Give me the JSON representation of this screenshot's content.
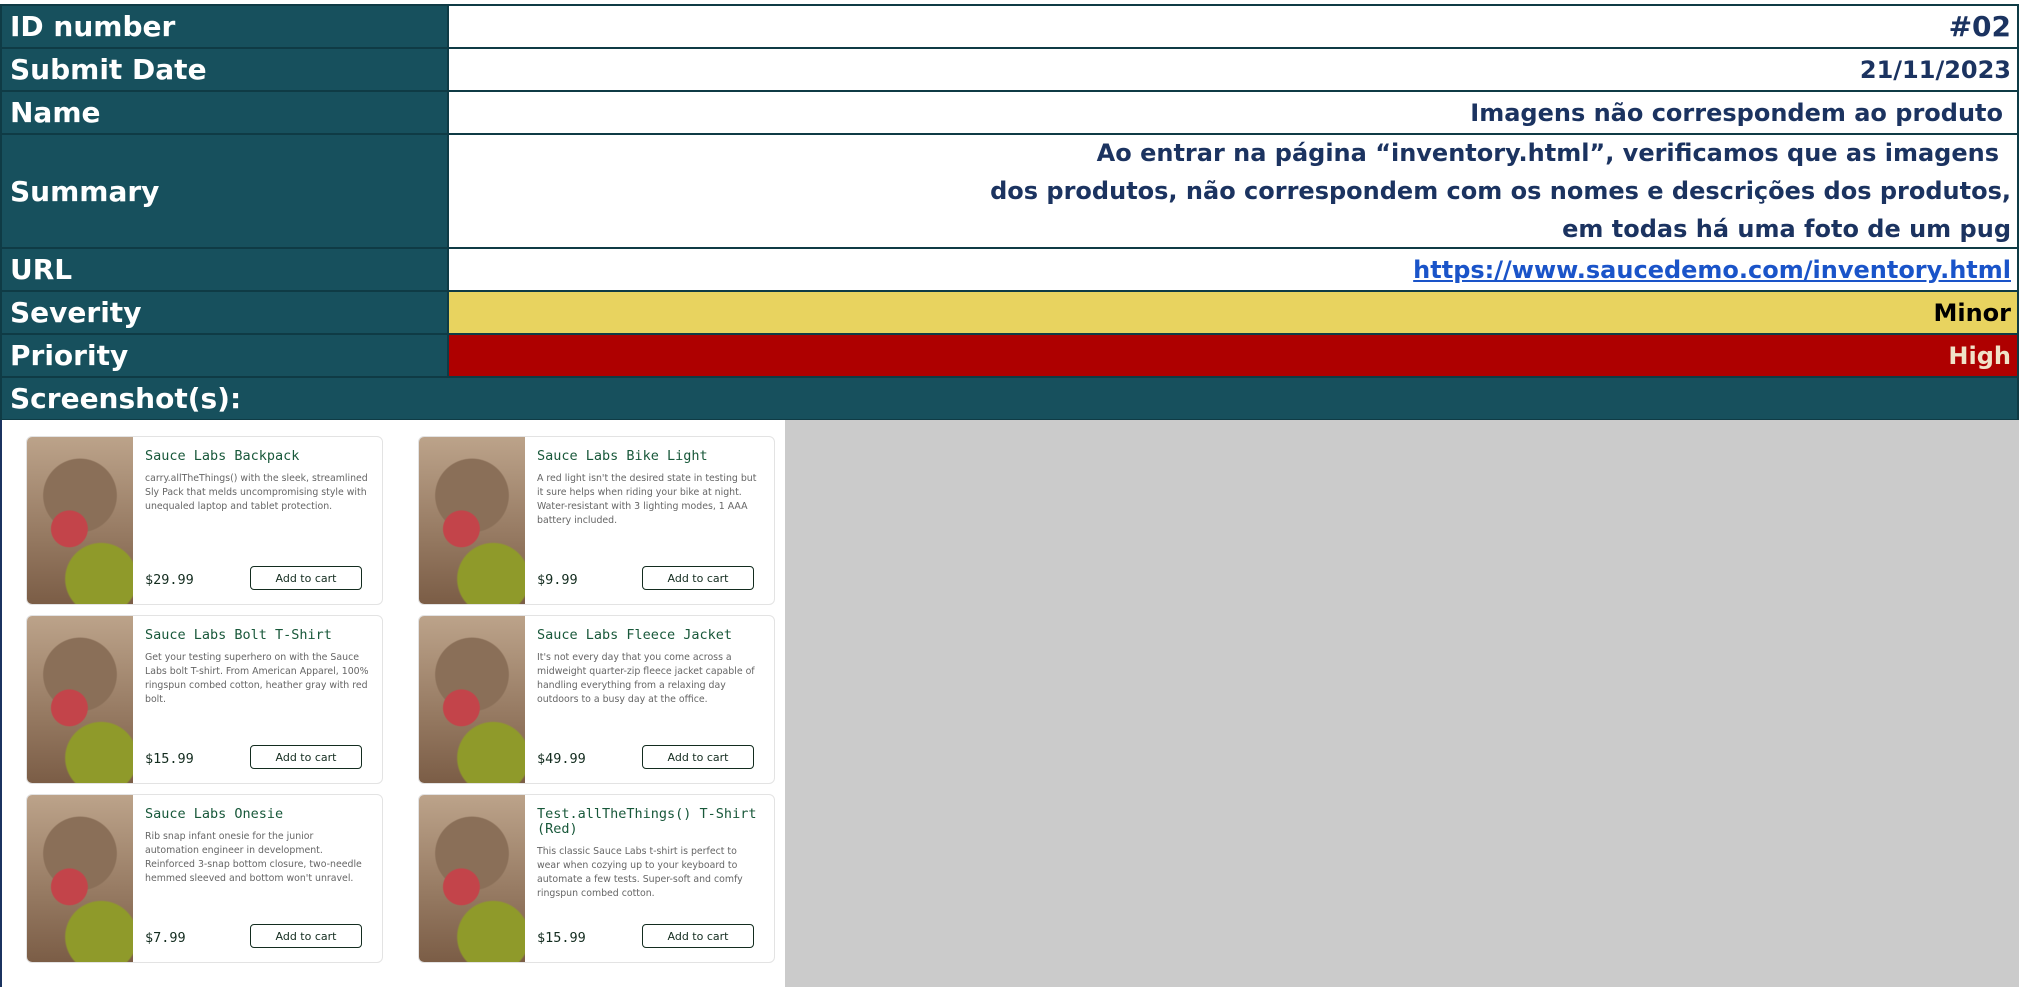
{
  "report": {
    "id_label": "ID number",
    "id_value": "#02",
    "date_label": "Submit Date",
    "date_value": "21/11/2023",
    "name_label": "Name",
    "name_value": "Imagens não correspondem ao produto",
    "summary_label": "Summary",
    "summary_lines": [
      "Ao entrar na página “inventory.html”,  verificamos que as imagens",
      "dos produtos, não correspondem com os nomes e descrições dos produtos,",
      "em todas há uma foto de um pug"
    ],
    "url_label": "URL",
    "url_value": "https://www.saucedemo.com/inventory.html",
    "severity_label": "Severity",
    "severity_value": "Minor",
    "priority_label": "Priority",
    "priority_value": "High",
    "screenshots_label": "Screenshot(s):"
  },
  "products": [
    {
      "name": "Sauce Labs Backpack",
      "desc": "carry.allTheThings() with the sleek, streamlined Sly Pack that melds uncompromising style with unequaled laptop and tablet protection.",
      "price": "$29.99",
      "button": "Add to cart"
    },
    {
      "name": "Sauce Labs Bike Light",
      "desc": "A red light isn't the desired state in testing but it sure helps when riding your bike at night. Water-resistant with 3 lighting modes, 1 AAA battery included.",
      "price": "$9.99",
      "button": "Add to cart"
    },
    {
      "name": "Sauce Labs Bolt T-Shirt",
      "desc": "Get your testing superhero on with the Sauce Labs bolt T-shirt. From American Apparel, 100% ringspun combed cotton, heather gray with red bolt.",
      "price": "$15.99",
      "button": "Add to cart"
    },
    {
      "name": "Sauce Labs Fleece Jacket",
      "desc": "It's not every day that you come across a midweight quarter-zip fleece jacket capable of handling everything from a relaxing day outdoors to a busy day at the office.",
      "price": "$49.99",
      "button": "Add to cart"
    },
    {
      "name": "Sauce Labs Onesie",
      "desc": "Rib snap infant onesie for the junior automation engineer in development. Reinforced 3-snap bottom closure, two-needle hemmed sleeved and bottom won't unravel.",
      "price": "$7.99",
      "button": "Add to cart"
    },
    {
      "name": "Test.allTheThings() T-Shirt (Red)",
      "desc": "This classic Sauce Labs t-shirt is perfect to wear when cozying up to your keyboard to automate a few tests. Super-soft and comfy ringspun combed cotton.",
      "price": "$15.99",
      "button": "Add to cart"
    }
  ],
  "colors": {
    "label_bg": "#17505d",
    "severity_bg": "#e8d35f",
    "priority_bg": "#ae0000",
    "value_text": "#1b3360"
  }
}
